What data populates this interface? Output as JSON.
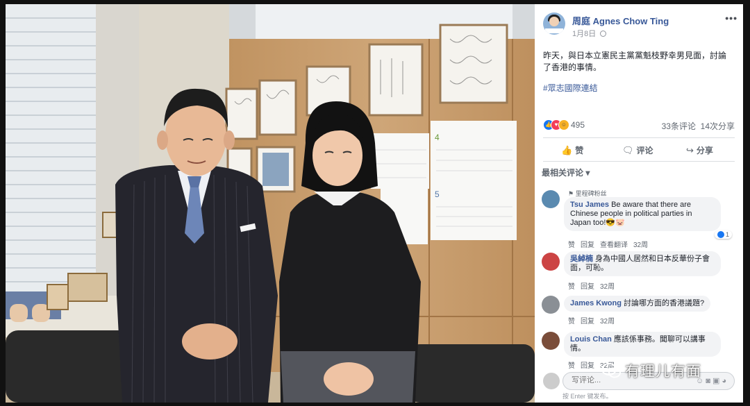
{
  "post": {
    "author": "周庭 Agnes Chow Ting",
    "date": "1月8日",
    "more_icon": "more-icon",
    "text": "昨天，與日本立憲民主黨黨魁枝野幸男見面，討論了香港的事情。",
    "hashtag": "#眾志國際連結"
  },
  "reactions": {
    "count": "495",
    "comments": "33条评论",
    "shares": "14次分享"
  },
  "actions": {
    "like": "赞",
    "comment": "评论",
    "share": "分享"
  },
  "comments_sort": "最相关评论",
  "comments": [
    {
      "label": "里程碑粉丝",
      "author": "Tsu James",
      "text": "Be aware that there are Chinese people in political parties in Japan too!😎🐷",
      "likes": "1",
      "actions": [
        "赞",
        "回复",
        "查看翻译",
        "32周"
      ]
    },
    {
      "author": "吳綽楠",
      "text": "身為中國人居然和日本反華份子會面，可恥。",
      "actions": [
        "赞",
        "回复",
        "32周"
      ]
    },
    {
      "author": "James Kwong",
      "text": "討論哪方面的香港議題?",
      "actions": [
        "赞",
        "回复",
        "32周"
      ]
    },
    {
      "author": "Louis Chan",
      "text": "應該係事務。聞聊可以講事情。",
      "actions": [
        "赞",
        "回复",
        "32周"
      ]
    }
  ],
  "composer": {
    "placeholder": "写评论...",
    "hint": "按 Enter 键发布。"
  },
  "watermark": "有理儿有面",
  "colors": {
    "link": "#385898",
    "like_blue": "#1877f2",
    "wall": "#c9a070"
  }
}
